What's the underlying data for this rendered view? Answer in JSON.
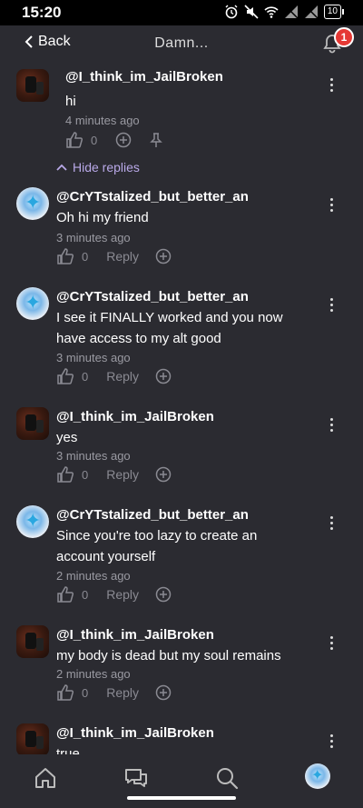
{
  "status_bar": {
    "time": "15:20",
    "battery": "10"
  },
  "header": {
    "back_label": "Back",
    "title": "Damn...",
    "notifications_count": "1"
  },
  "replies_toggle": "Hide replies",
  "labels": {
    "reply": "Reply"
  },
  "comments": [
    {
      "author": "@I_think_im_JailBroken",
      "text": "hi",
      "time": "4 minutes ago",
      "likes": "0"
    },
    {
      "author": "@CrYTstalized_but_better_an",
      "text": "Oh hi my friend",
      "time": "3 minutes ago",
      "likes": "0"
    },
    {
      "author": "@CrYTstalized_but_better_an",
      "text_lines": [
        "I see it FINALLY worked and you now",
        "have access to my alt good"
      ],
      "time": "3 minutes ago",
      "likes": "0"
    },
    {
      "author": "@I_think_im_JailBroken",
      "text": "yes",
      "time": "3 minutes ago",
      "likes": "0"
    },
    {
      "author": "@CrYTstalized_but_better_an",
      "text_lines": [
        "Since you're too lazy to create an",
        "account yourself"
      ],
      "time": "2 minutes ago",
      "likes": "0"
    },
    {
      "author": "@I_think_im_JailBroken",
      "text": "my body is dead but my soul remains",
      "time": "2 minutes ago",
      "likes": "0"
    },
    {
      "author": "@I_think_im_JailBroken",
      "text": "true"
    }
  ],
  "icons": {
    "status": [
      "alarm-icon",
      "mute-icon",
      "wifi-icon",
      "signal-icon",
      "signal-icon",
      "battery-icon"
    ],
    "nav": [
      "home-icon",
      "chat-icon",
      "search-icon",
      "profile-avatar"
    ]
  }
}
